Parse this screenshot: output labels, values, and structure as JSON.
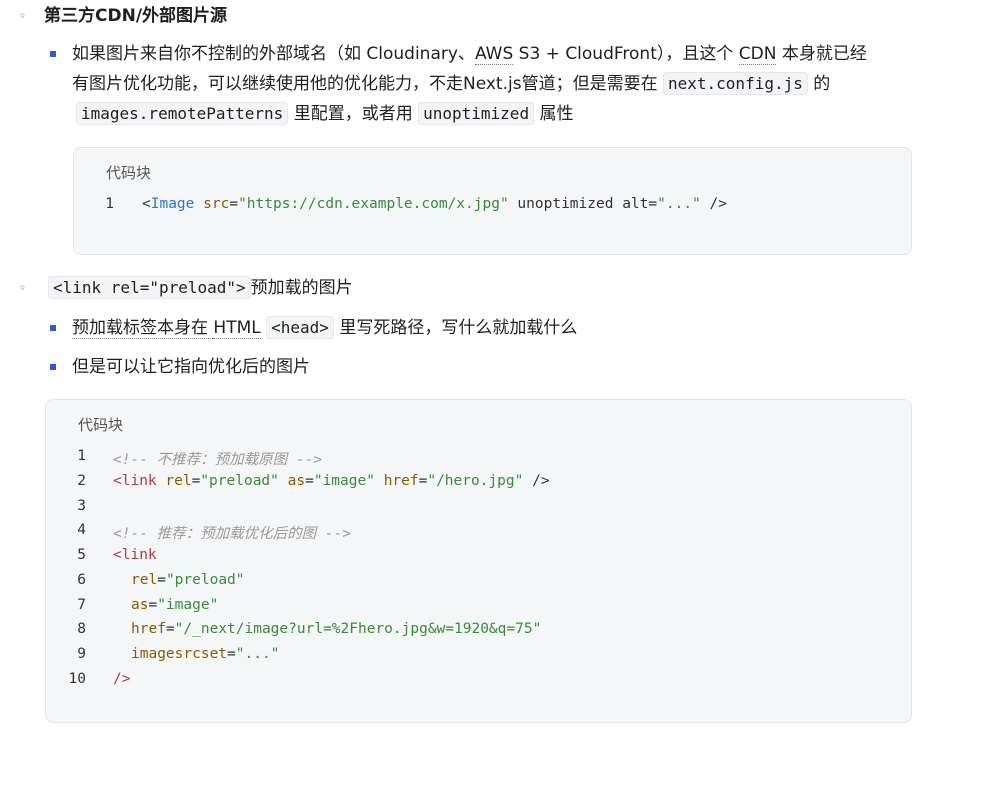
{
  "section1": {
    "heading": "第三方CDN/外部图片源",
    "para_a": "如果图片来自你不控制的外部域名（如 Cloudinary、",
    "para_b": "AWS",
    "para_c": " S3 + CloudFront），且这个 ",
    "para_d": "CDN",
    "para_e": " 本身就已经",
    "para_f": "有图片优化功能，可以继续使用他的优化能力，不走Next.js管道；但是需要在 ",
    "code1": "next.config.js",
    "para_g": " 的",
    "code2": "images.remotePatterns",
    "para_h": " 里配置，或者用 ",
    "code3": "unoptimized",
    "para_i": " 属性",
    "codeblock_title": "代码块",
    "line_no": "1",
    "code_line": {
      "p1": "<",
      "tag": "Image",
      "p2": " ",
      "attr1": "src",
      "eq1": "=",
      "val1": "\"https://cdn.example.com/x.jpg\"",
      "p3": " ",
      "attr2": "unoptimized",
      "p4": " ",
      "attr3": "alt",
      "eq2": "=",
      "val2": "\"...\"",
      "p5": " />"
    }
  },
  "section2": {
    "heading_code": "<link rel=\"preload\">",
    "heading_text": "预加载的图片",
    "item1_a": "预加载标签本身在 ",
    "item1_b": "HTML",
    "item1_c": " ",
    "item1_code": "<head>",
    "item1_d": " 里写死路径，写什么就加载什么",
    "item2": "但是可以让它指向优化后的图片",
    "codeblock_title": "代码块",
    "lines": [
      {
        "n": "1"
      },
      {
        "n": "2"
      },
      {
        "n": "3"
      },
      {
        "n": "4"
      },
      {
        "n": "5"
      },
      {
        "n": "6"
      },
      {
        "n": "7"
      },
      {
        "n": "8"
      },
      {
        "n": "9"
      },
      {
        "n": "10"
      }
    ],
    "l1": "<!-- 不推荐：预加载原图 -->",
    "l2": {
      "lt": "<",
      "tag": "link",
      "s1": " ",
      "a1": "rel",
      "e1": "=",
      "v1": "\"preload\"",
      "s2": " ",
      "a2": "as",
      "e2": "=",
      "v2": "\"image\"",
      "s3": " ",
      "a3": "href",
      "e3": "=",
      "v3": "\"/hero.jpg\"",
      "end": " />"
    },
    "l4": "<!-- 推荐：预加载优化后的图 -->",
    "l5": {
      "lt": "<",
      "tag": "link"
    },
    "l6": {
      "a": "rel",
      "e": "=",
      "v": "\"preload\""
    },
    "l7": {
      "a": "as",
      "e": "=",
      "v": "\"image\""
    },
    "l8": {
      "a": "href",
      "e": "=",
      "v": "\"/_next/image?url=%2Fhero.jpg&w=1920&q=75\""
    },
    "l9": {
      "a": "imagesrcset",
      "e": "=",
      "v": "\"...\""
    },
    "l10": "/>"
  }
}
